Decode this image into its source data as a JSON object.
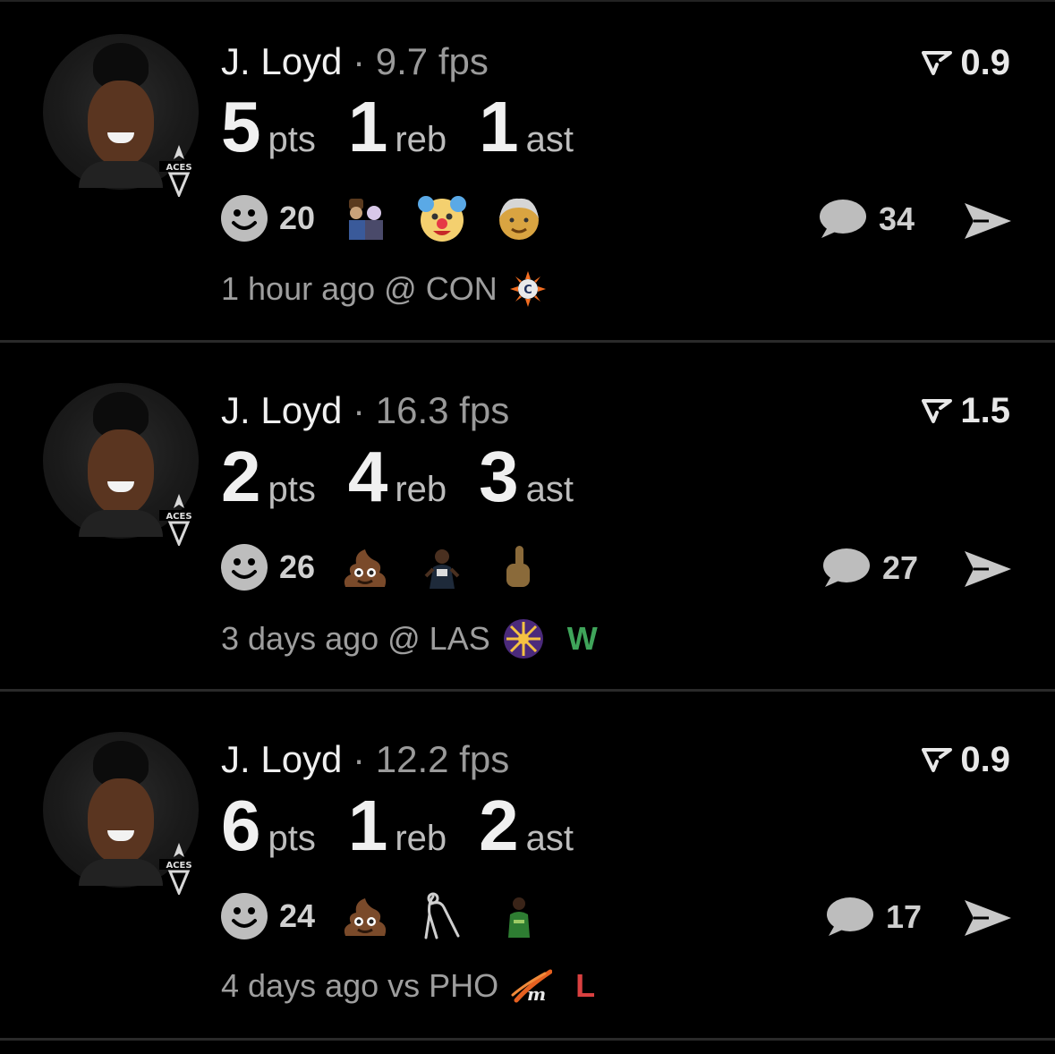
{
  "cards": [
    {
      "player": "J. Loyd",
      "separator": "·",
      "fps": "9.7 fps",
      "rating": "0.9",
      "stats": [
        {
          "value": "5",
          "unit": "pts"
        },
        {
          "value": "1",
          "unit": "reb"
        },
        {
          "value": "1",
          "unit": "ast"
        }
      ],
      "reaction_count": "20",
      "reaction_emojis": [
        "woody-buzz-sticker",
        "clown-emoji",
        "old-person-emoji"
      ],
      "comment_count": "34",
      "meta": "1 hour ago @ CON",
      "opponent_logo": "sun-logo",
      "result": ""
    },
    {
      "player": "J. Loyd",
      "separator": "·",
      "fps": "16.3 fps",
      "rating": "1.5",
      "stats": [
        {
          "value": "2",
          "unit": "pts"
        },
        {
          "value": "4",
          "unit": "reb"
        },
        {
          "value": "3",
          "unit": "ast"
        }
      ],
      "reaction_count": "26",
      "reaction_emojis": [
        "poop-emoji",
        "man-sticker",
        "middle-finger-emoji"
      ],
      "comment_count": "27",
      "meta": "3 days ago @ LAS",
      "opponent_logo": "sparks-logo",
      "result": "W"
    },
    {
      "player": "J. Loyd",
      "separator": "·",
      "fps": "12.2 fps",
      "rating": "0.9",
      "stats": [
        {
          "value": "6",
          "unit": "pts"
        },
        {
          "value": "1",
          "unit": "reb"
        },
        {
          "value": "2",
          "unit": "ast"
        }
      ],
      "reaction_count": "24",
      "reaction_emojis": [
        "poop-emoji",
        "cane-figure-sticker",
        "goalkeeper-sticker"
      ],
      "comment_count": "17",
      "meta": "4 days ago vs PHO",
      "opponent_logo": "mercury-logo",
      "result": "L"
    }
  ],
  "team_badge_text": "ACES",
  "colors": {
    "background": "#000000",
    "win": "#3fa45a",
    "loss": "#d94040",
    "muted": "#9e9e9e"
  }
}
